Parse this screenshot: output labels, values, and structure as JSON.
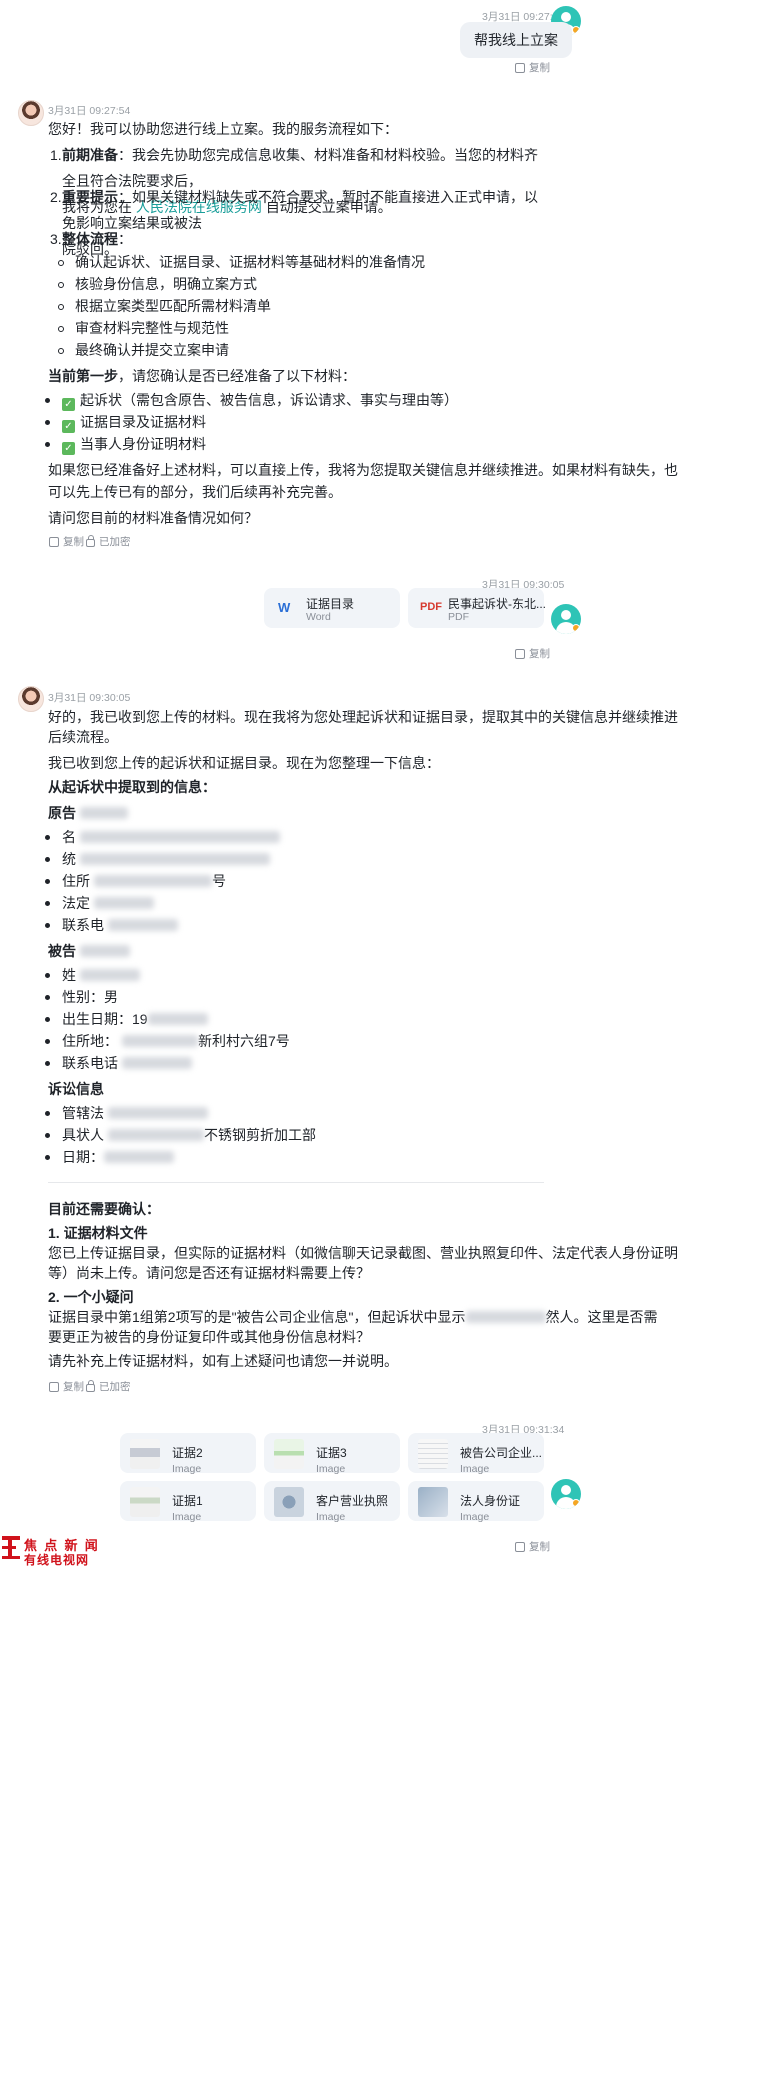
{
  "msg1": {
    "time": "3月31日 09:27:54",
    "text": "帮我线上立案",
    "copy": "复制"
  },
  "msg2": {
    "time": "3月31日 09:27:54",
    "intro": "您好！我可以协助您进行线上立案。我的服务流程如下：",
    "item1_label": "前期准备",
    "item1_text_a": "：我会先协助您完成信息收集、材料准备和材料校验。当您的材料齐全且符合法院要求后，",
    "item1_text_b_pre": "我将为您在 ",
    "item1_link": "人民法院在线服务网",
    "item1_text_b_post": " 自动提交立案申请。",
    "item2_label": "重要提示",
    "item2_text_a": "：如果关键材料缺失或不符合要求，暂时不能直接进入正式申请，以免影响立案结果或被法",
    "item2_text_b": "院驳回。",
    "item3_label": "整体流程",
    "item3_colon": "：",
    "steps": [
      "确认起诉状、证据目录、证据材料等基础材料的准备情况",
      "核验身份信息，明确立案方式",
      "根据立案类型匹配所需材料清单",
      "审查材料完整性与规范性",
      "最终确认并提交立案申请"
    ],
    "first_step_label": "当前第一步",
    "first_step_text": "，请您确认是否已经准备了以下材料：",
    "checks": [
      "起诉状（需包含原告、被告信息，诉讼请求、事实与理由等）",
      "证据目录及证据材料",
      "当事人身份证明材料"
    ],
    "check_mark": "✓",
    "para_a": "如果您已经准备好上述材料，可以直接上传，我将为您提取关键信息并继续推进。如果材料有缺失，也",
    "para_b": "可以先上传已有的部分，我们后续再补充完善。",
    "question": "请问您目前的材料准备情况如何？",
    "copy": "复制",
    "encrypted": "已加密"
  },
  "msg3": {
    "time": "3月31日 09:30:05",
    "files": [
      {
        "icon": "W",
        "name": "证据目录",
        "type": "Word"
      },
      {
        "icon": "PDF",
        "name": "民事起诉状-东北...",
        "type": "PDF"
      }
    ],
    "copy": "复制"
  },
  "msg4": {
    "time": "3月31日 09:30:05",
    "p1a": "好的，我已收到您上传的材料。现在我将为您处理起诉状和证据目录，提取其中的关键信息并继续推进",
    "p1b": "后续流程。",
    "p2": "我已收到您上传的起诉状和证据目录。现在为您整理一下信息：",
    "h_extract": "从起诉状中提取到的信息：",
    "h_plaintiff": "原告",
    "plaintiff": [
      "名",
      "统",
      "住所",
      "号",
      "法定",
      "联系电"
    ],
    "h_defendant": "被告",
    "defendant": [
      "姓",
      "性别：男",
      "出生日期：19",
      "住所地：",
      "新利村六组7号",
      "联系电话"
    ],
    "h_lawsuit": "诉讼信息",
    "lawsuit": [
      "管辖法",
      "具状人",
      "不锈钢剪折加工部",
      "日期："
    ],
    "h_confirm": "目前还需要确认：",
    "c1_title": "1. 证据材料文件",
    "c1a": "您已上传证据目录，但实际的证据材料（如微信聊天记录截图、营业执照复印件、法定代表人身份证明",
    "c1b": "等）尚未上传。请问您是否还有证据材料需要上传？",
    "c2_title": "2. 一个小疑问",
    "c2a_pre": "证据目录中第1组第2项写的是\"被告公司企业信息\"，但起诉状中显示",
    "c2a_post": "然人。这里是否需",
    "c2b": "要更正为被告的身份证复印件或其他身份信息材料？",
    "c3": "请先补充上传证据材料，如有上述疑问也请您一并说明。",
    "copy": "复制",
    "encrypted": "已加密"
  },
  "msg5": {
    "time": "3月31日 09:31:34",
    "images": [
      {
        "name": "证据2",
        "type": "Image"
      },
      {
        "name": "证据3",
        "type": "Image"
      },
      {
        "name": "被告公司企业...",
        "type": "Image"
      },
      {
        "name": "证据1",
        "type": "Image"
      },
      {
        "name": "客户营业执照",
        "type": "Image"
      },
      {
        "name": "法人身份证",
        "type": "Image"
      }
    ],
    "copy": "复制"
  },
  "watermark": {
    "line1": "焦 点 新 闻",
    "line2": "有线电视网"
  },
  "colors": {
    "link": "#1a9e9a",
    "accent_avatar": "#2ec4b6",
    "pdf_red": "#d63a2f",
    "word_blue": "#2b6fd6",
    "check_green": "#5cb85c",
    "watermark_red": "#d0121b"
  }
}
